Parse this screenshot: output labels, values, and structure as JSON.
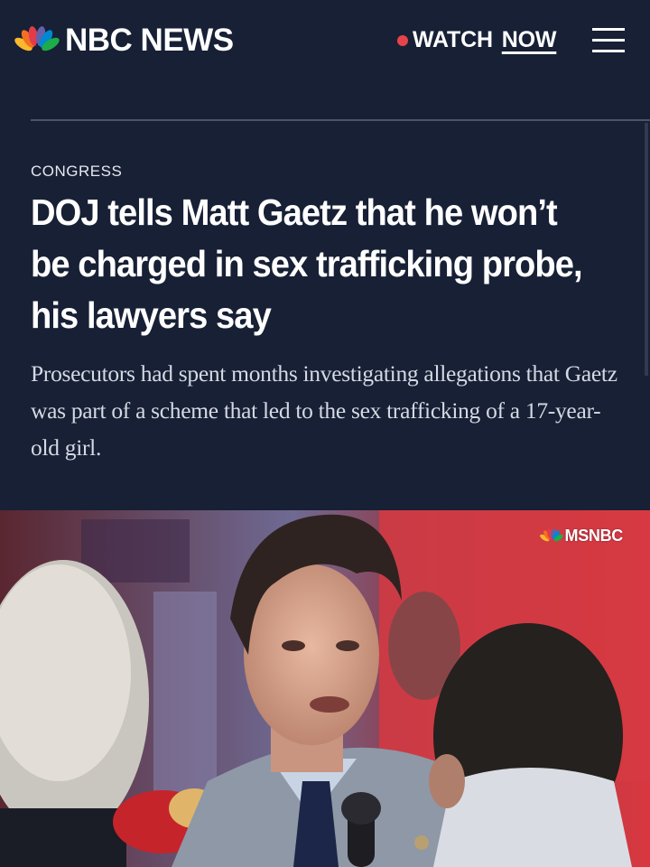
{
  "header": {
    "brand": "NBC NEWS",
    "watch_label": "WATCH",
    "now_label": "NOW",
    "live_dot_color": "#e8434b",
    "menu_icon": "hamburger-menu-icon"
  },
  "article": {
    "category": "CONGRESS",
    "headline": "DOJ tells Matt Gaetz that he won’t be charged in sex trafficking probe, his lawyers say",
    "dek": "Prosecutors had spent months investigating allegations that Gaetz was part of a scheme that led to the sex trafficking of a 17-year-old girl."
  },
  "photo": {
    "watermark": "MSNBC",
    "watermark_icon": "peacock-logo-icon"
  },
  "colors": {
    "background": "#172035",
    "divider": "#4b5468",
    "text": "#ffffff",
    "dek_text": "#d5d9e3",
    "peacock": [
      "#f8b92e",
      "#f36f21",
      "#e23c4a",
      "#6460aa",
      "#0089d0",
      "#1eac4b"
    ]
  }
}
